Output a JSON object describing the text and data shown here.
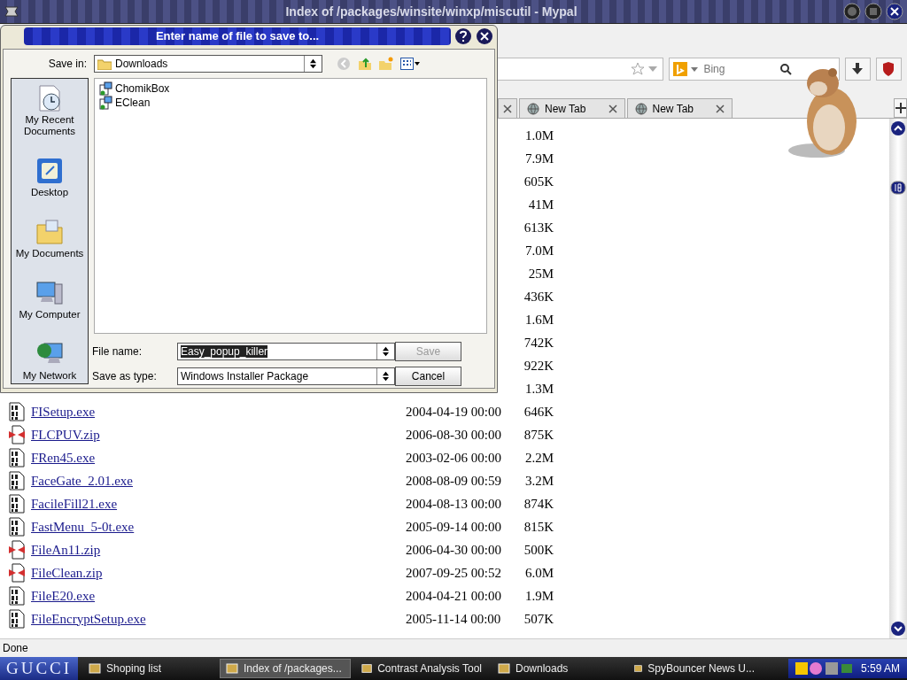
{
  "window": {
    "title": "Index of /packages/winsite/winxp/miscutil - Mypal"
  },
  "search": {
    "placeholder": "Bing"
  },
  "tabs": [
    {
      "label": "New Tab",
      "selected": false
    },
    {
      "label": "New Tab",
      "selected": false
    }
  ],
  "listing": {
    "rows": [
      {
        "size": "1.0M"
      },
      {
        "size": "7.9M"
      },
      {
        "size": "605K"
      },
      {
        "size": "41M"
      },
      {
        "size": "613K"
      },
      {
        "size": "7.0M"
      },
      {
        "size": "25M"
      },
      {
        "size": "436K"
      },
      {
        "size": "1.6M"
      },
      {
        "size": "742K"
      },
      {
        "size": "922K"
      },
      {
        "size": "1.3M"
      },
      {
        "kind": "exe",
        "name": "FISetup.exe",
        "date": "2004-04-19 00:00",
        "size": "646K"
      },
      {
        "kind": "zip",
        "name": "FLCPUV.zip",
        "date": "2006-08-30 00:00",
        "size": "875K"
      },
      {
        "kind": "exe",
        "name": "FRen45.exe",
        "date": "2003-02-06 00:00",
        "size": "2.2M"
      },
      {
        "kind": "exe",
        "name": "FaceGate_2.01.exe",
        "date": "2008-08-09 00:59",
        "size": "3.2M"
      },
      {
        "kind": "exe",
        "name": "FacileFill21.exe",
        "date": "2004-08-13 00:00",
        "size": "874K"
      },
      {
        "kind": "exe",
        "name": "FastMenu_5-0t.exe",
        "date": "2005-09-14 00:00",
        "size": "815K"
      },
      {
        "kind": "zip",
        "name": "FileAn11.zip",
        "date": "2006-04-30 00:00",
        "size": "500K"
      },
      {
        "kind": "zip",
        "name": "FileClean.zip",
        "date": "2007-09-25 00:52",
        "size": "6.0M"
      },
      {
        "kind": "exe",
        "name": "FileE20.exe",
        "date": "2004-04-21 00:00",
        "size": "1.9M"
      },
      {
        "kind": "exe",
        "name": "FileEncryptSetup.exe",
        "date": "2005-11-14 00:00",
        "size": "507K"
      }
    ]
  },
  "dialog": {
    "title": "Enter name of file to save to...",
    "save_in_label": "Save in:",
    "save_in": "Downloads",
    "places": [
      {
        "kind": "recent",
        "label": "My Recent Documents"
      },
      {
        "kind": "desktop",
        "label": "Desktop"
      },
      {
        "kind": "documents",
        "label": "My Documents"
      },
      {
        "kind": "computer",
        "label": "My Computer"
      },
      {
        "kind": "network",
        "label": "My Network"
      }
    ],
    "files": [
      {
        "name": "ChomikBox"
      },
      {
        "name": "EClean"
      }
    ],
    "file_name_label": "File name:",
    "file_name": {
      "value": "Easy_popup_killer",
      "selected": true
    },
    "type_label": "Save as type:",
    "save_as_type": "Windows Installer Package",
    "buttons": [
      {
        "label": "Save",
        "disabled": true
      },
      {
        "label": "Cancel",
        "disabled": false
      }
    ]
  },
  "status_bar": "Done",
  "taskbar": {
    "start": "GUCCI",
    "tasks": [
      {
        "label": "Shoping list",
        "selected": false
      },
      {
        "label": "Index of /packages...",
        "selected": true
      },
      {
        "label": "Contrast Analysis Tool",
        "selected": false
      },
      {
        "label": "Downloads",
        "selected": false
      },
      {
        "label": "SpyBouncer News U...",
        "selected": false
      }
    ],
    "clock": "5:59 AM"
  }
}
